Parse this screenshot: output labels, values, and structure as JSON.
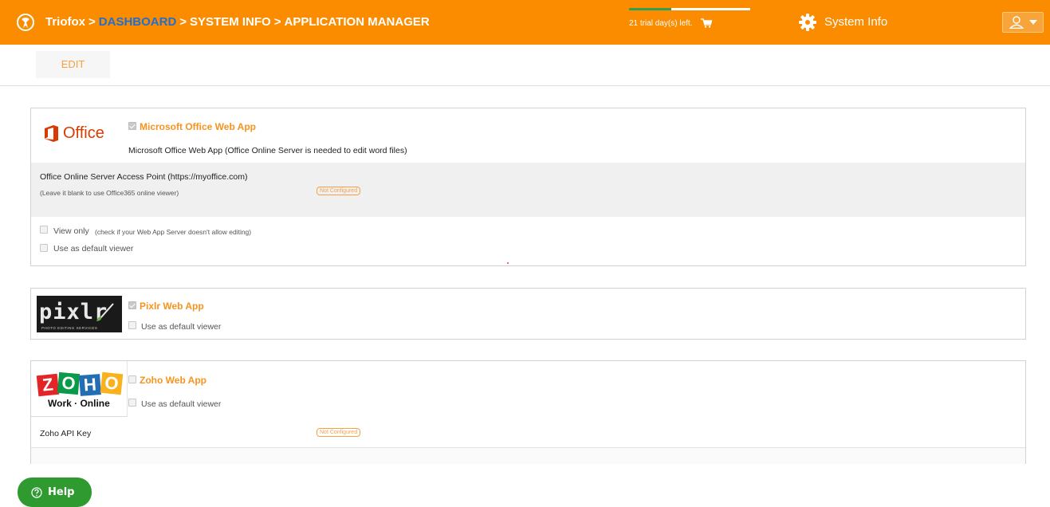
{
  "header": {
    "brand": "Triofox",
    "separator": ">",
    "breadcrumb": [
      "DASHBOARD",
      "SYSTEM INFO",
      "APPLICATION MANAGER"
    ],
    "trial_text": "21 trial day(s) left.",
    "trial_progress": 0.35,
    "system_info_label": "System Info",
    "colors": {
      "header_bg": "#fb8c00",
      "link": "#1f6fd1",
      "progress": "#2e9e52"
    }
  },
  "toolbar": {
    "edit_label": "EDIT"
  },
  "apps": {
    "office": {
      "logo_text": "Office",
      "enabled": true,
      "title": "Microsoft Office Web App",
      "description": "Microsoft Office Web App (Office Online Server is needed to edit word files)",
      "access_point_label": "Office Online Server Access Point (https://myoffice.com)",
      "access_point_hint": "(Leave it blank to use Office365 online viewer)",
      "status": "Not Configured",
      "view_only_label": "View only",
      "view_only_hint": "(check if your Web App Server doesn't allow editing)",
      "default_viewer_label": "Use as default viewer"
    },
    "pixlr": {
      "logo_text": "pixlr",
      "logo_subtitle": "PHOTO EDITING SERVICES",
      "enabled": true,
      "title": "Pixlr Web App",
      "default_viewer_label": "Use as default viewer"
    },
    "zoho": {
      "logo_letters": [
        "Z",
        "O",
        "H",
        "O"
      ],
      "logo_subtitle": "Work · Online",
      "enabled": false,
      "title": "Zoho Web App",
      "default_viewer_label": "Use as default viewer",
      "api_key_label": "Zoho API Key",
      "status": "Not Configured"
    }
  },
  "help": {
    "label": "Help"
  },
  "icons": [
    "triofox-logo-icon",
    "cart-icon",
    "gear-icon",
    "user-icon",
    "chevron-down-icon",
    "office-logo-icon",
    "brush-icon",
    "help-circle-icon"
  ]
}
